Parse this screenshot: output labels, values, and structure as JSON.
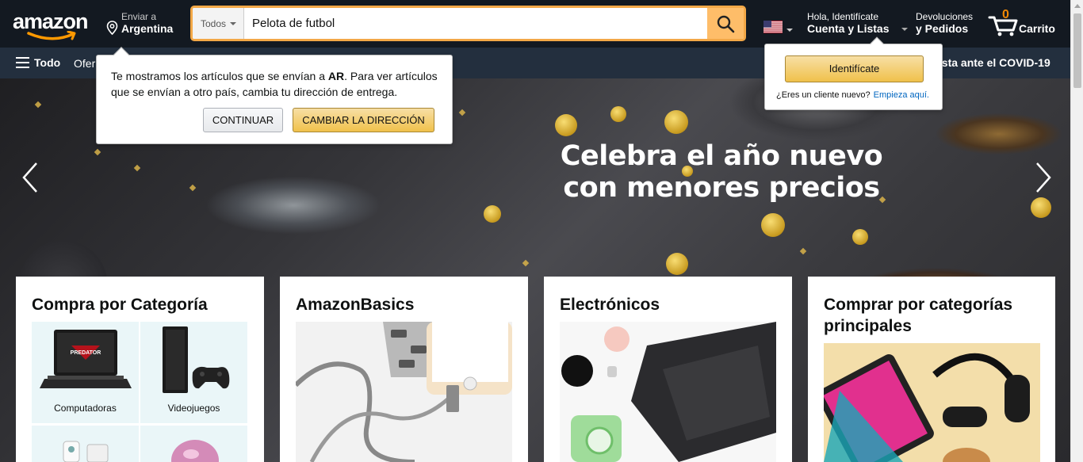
{
  "header": {
    "logo_text": "amazon",
    "deliver_line1": "Enviar a",
    "deliver_line2": "Argentina",
    "search": {
      "department": "Todos",
      "value": "Pelota de futbol"
    },
    "account_line1": "Hola, Identifícate",
    "account_line2": "Cuenta y Listas",
    "orders_line1": "Devoluciones",
    "orders_line2": "y Pedidos",
    "cart_count": "0",
    "cart_label": "Carrito"
  },
  "subnav": {
    "all_label": "Todo",
    "ofertas_partial": "Ofer",
    "covid_partial": "esta ante el COVID-19"
  },
  "location_popover": {
    "text_before": "Te mostramos los artículos que se envían a ",
    "country": "AR",
    "text_after": ". Para ver artículos que se envían a otro país, cambia tu dirección de entrega.",
    "continue_label": "CONTINUAR",
    "change_label": "CAMBIAR LA DIRECCIÓN"
  },
  "signin_flyout": {
    "button_label": "Identifícate",
    "new_customer": "¿Eres un cliente nuevo?",
    "start_here": "Empieza aquí."
  },
  "hero": {
    "line1": "Celebra el año nuevo",
    "line2": "con menores precios"
  },
  "cards": [
    {
      "title": "Compra por Categoría",
      "tiles": [
        "Computadoras",
        "Videojuegos"
      ]
    },
    {
      "title": "AmazonBasics"
    },
    {
      "title": "Electrónicos"
    },
    {
      "title": "Comprar por categorías principales"
    }
  ],
  "colors": {
    "nav_dark": "#131921",
    "nav_sub": "#232f3e",
    "search_button": "#febd69",
    "cart_count": "#f08804",
    "button_yellow": "#f0c14b",
    "link_blue": "#0066c0"
  },
  "icons": [
    "location-pin-icon",
    "search-icon",
    "us-flag-icon",
    "cart-icon",
    "hamburger-icon",
    "chevron-left-icon",
    "chevron-right-icon"
  ]
}
